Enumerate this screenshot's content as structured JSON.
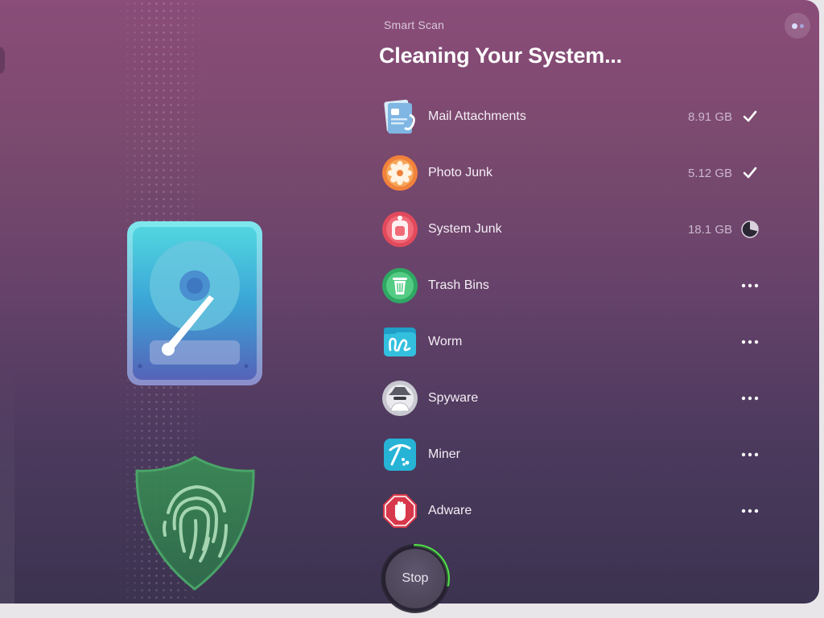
{
  "header": {
    "section_label": "Smart Scan",
    "title": "Cleaning Your System..."
  },
  "items": [
    {
      "label": "Mail Attachments",
      "size": "8.91 GB",
      "status": "done",
      "icon": "mail-attachments-icon"
    },
    {
      "label": "Photo Junk",
      "size": "5.12 GB",
      "status": "done",
      "icon": "photo-junk-icon"
    },
    {
      "label": "System Junk",
      "size": "18.1 GB",
      "status": "in-progress",
      "icon": "system-junk-icon"
    },
    {
      "label": "Trash Bins",
      "size": "",
      "status": "pending",
      "icon": "trash-bins-icon"
    },
    {
      "label": "Worm",
      "size": "",
      "status": "pending",
      "icon": "worm-icon"
    },
    {
      "label": "Spyware",
      "size": "",
      "status": "pending",
      "icon": "spyware-icon"
    },
    {
      "label": "Miner",
      "size": "",
      "status": "pending",
      "icon": "miner-icon"
    },
    {
      "label": "Adware",
      "size": "",
      "status": "pending",
      "icon": "adware-icon"
    }
  ],
  "stop_button": {
    "label": "Stop",
    "progress": 0.28
  },
  "colors": {
    "background_top": "#8a4c79",
    "background_bottom": "#3b3350",
    "progress_ring": "#52e04a",
    "text_primary": "#ffffff",
    "text_secondary": "#cbb6cf"
  },
  "illustrations": [
    "hard-disk-icon",
    "fingerprint-shield-icon"
  ]
}
